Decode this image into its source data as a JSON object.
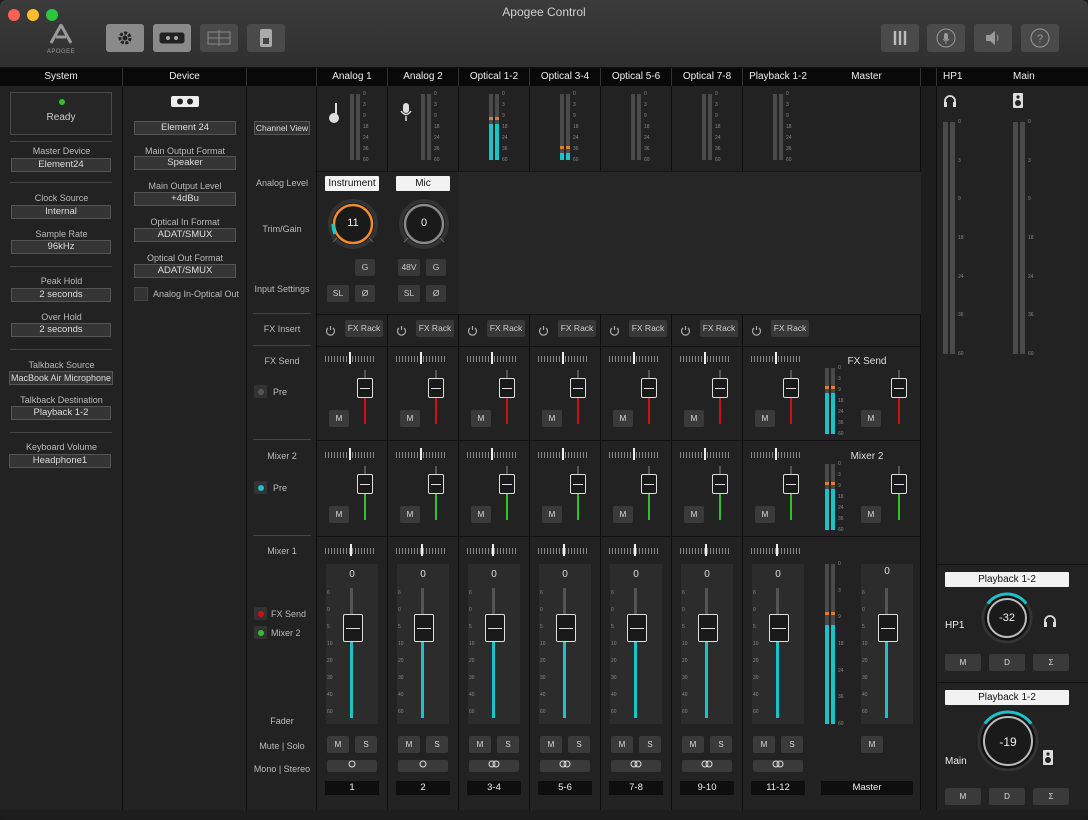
{
  "window": {
    "title": "Apogee Control",
    "logo": "APOGEE"
  },
  "colors": {
    "accent": "#19c3c9",
    "gain_ring": "#f08a30",
    "meter_peak": "#e07a2c",
    "ready_led": "#30c030",
    "mute_red": "#d01010"
  },
  "toolbar_left": [
    {
      "icon": "gear-icon",
      "active": true
    },
    {
      "icon": "device-icon",
      "active": true
    },
    {
      "icon": "mixer-layout-icon",
      "active": false
    },
    {
      "icon": "remote-icon",
      "active": false
    }
  ],
  "toolbar_right": [
    {
      "icon": "meter-bridge-icon"
    },
    {
      "icon": "talkback-mic-icon"
    },
    {
      "icon": "speaker-icon"
    },
    {
      "icon": "help-icon"
    }
  ],
  "system": {
    "header": "System",
    "status": "Ready",
    "master_device_label": "Master Device",
    "master_device": "Element24",
    "clock_source_label": "Clock Source",
    "clock_source": "Internal",
    "sample_rate_label": "Sample Rate",
    "sample_rate": "96kHz",
    "peak_hold_label": "Peak Hold",
    "peak_hold": "2 seconds",
    "over_hold_label": "Over Hold",
    "over_hold": "2 seconds",
    "talkback_source_label": "Talkback Source",
    "talkback_source": "MacBook Air Microphone",
    "talkback_dest_label": "Talkback Destination",
    "talkback_dest": "Playback 1-2",
    "keyboard_volume_label": "Keyboard Volume",
    "keyboard_volume": "Headphone1"
  },
  "device": {
    "header": "Device",
    "name": "Element 24",
    "main_output_format_label": "Main Output Format",
    "main_output_format": "Speaker",
    "main_output_level_label": "Main Output Level",
    "main_output_level": "+4dBu",
    "optical_in_format_label": "Optical In Format",
    "optical_in_format": "ADAT/SMUX",
    "optical_out_format_label": "Optical Out Format",
    "optical_out_format": "ADAT/SMUX",
    "analog_in_optical_out_label": "Analog In-Optical Out"
  },
  "row_labels": {
    "channel_view": "Channel View",
    "analog_level": "Analog Level",
    "trim_gain": "Trim/Gain",
    "input_settings": "Input Settings",
    "fx_insert": "FX Insert",
    "fx_send": "FX Send",
    "pre": "Pre",
    "mixer2": "Mixer 2",
    "mixer1": "Mixer 1",
    "fx_send_dot": "FX Send",
    "mixer2_dot": "Mixer 2",
    "fader": "Fader",
    "mute_solo": "Mute | Solo",
    "mono_stereo": "Mono | Stereo"
  },
  "meter_scale": [
    "0",
    "3",
    "9",
    "18",
    "24",
    "36",
    "60"
  ],
  "fader_scale": [
    "6",
    "0",
    "5",
    "10",
    "20",
    "30",
    "40",
    "60"
  ],
  "buttons": {
    "g": "G",
    "sl": "SL",
    "phase": "Ø",
    "v48": "48V",
    "fx_rack": "FX Rack",
    "m": "M",
    "s": "S",
    "d": "D",
    "sum": "Σ"
  },
  "channels": [
    {
      "header": "Analog 1",
      "number": "1",
      "icon": "guitar-icon",
      "level": "Instrument",
      "gain": "11",
      "stereo": false,
      "fader_value": "0",
      "meter_fill": 0,
      "phantom": false
    },
    {
      "header": "Analog 2",
      "number": "2",
      "icon": "microphone-icon",
      "level": "Mic",
      "gain": "0",
      "stereo": false,
      "fader_value": "0",
      "meter_fill": 0,
      "phantom": true
    },
    {
      "header": "Optical 1-2",
      "number": "3-4",
      "icon": "",
      "stereo": true,
      "fader_value": "0",
      "meter_fill": 0.55
    },
    {
      "header": "Optical 3-4",
      "number": "5-6",
      "icon": "",
      "stereo": true,
      "fader_value": "0",
      "meter_fill": 0.1
    },
    {
      "header": "Optical 5-6",
      "number": "7-8",
      "icon": "",
      "stereo": true,
      "fader_value": "0",
      "meter_fill": 0
    },
    {
      "header": "Optical 7-8",
      "number": "9-10",
      "icon": "",
      "stereo": true,
      "fader_value": "0",
      "meter_fill": 0
    },
    {
      "header": "Playback 1-2",
      "number": "11-12",
      "icon": "",
      "stereo": true,
      "fader_value": "0",
      "meter_fill": 0
    }
  ],
  "master": {
    "header": "Master",
    "fx_send": "FX Send",
    "mixer2": "Mixer 2",
    "fader_value": "0",
    "name": "Master",
    "meter_fill": 0.62
  },
  "outputs": {
    "hp1_header": "HP1",
    "main_header": "Main",
    "hp1": {
      "source": "Playback 1-2",
      "label": "HP1",
      "value": "-32",
      "level": 0.45
    },
    "main": {
      "source": "Playback 1-2",
      "label": "Main",
      "value": "-19",
      "level": 0.62
    }
  }
}
